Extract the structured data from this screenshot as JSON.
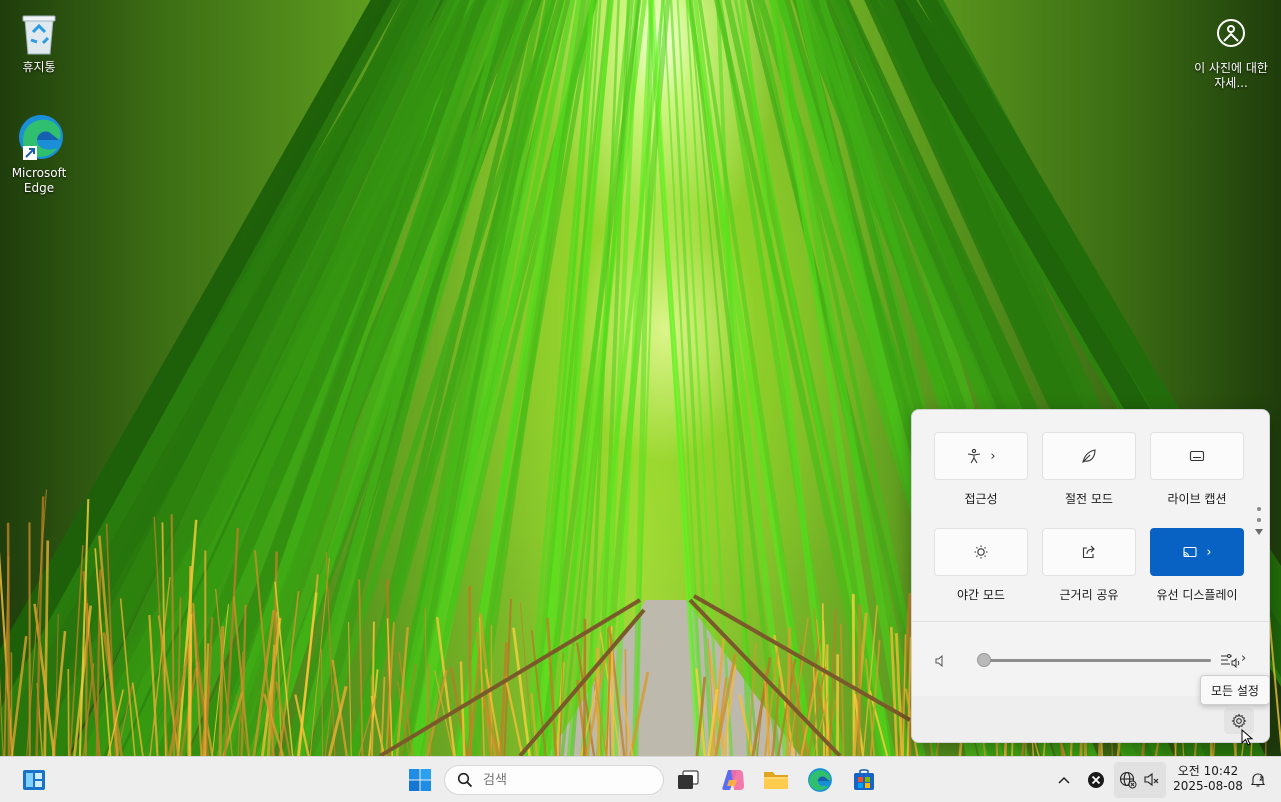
{
  "desktop": {
    "icons": [
      {
        "label": "휴지통"
      },
      {
        "label": "Microsoft Edge"
      }
    ],
    "spotlight": {
      "label": "이 사진에 대한 자세..."
    }
  },
  "quick_settings": {
    "tiles": [
      {
        "label": "접근성",
        "icon": "accessibility-icon",
        "has_chevron": true,
        "on": false
      },
      {
        "label": "절전 모드",
        "icon": "leaf-icon",
        "has_chevron": false,
        "on": false
      },
      {
        "label": "라이브 캡션",
        "icon": "captions-icon",
        "has_chevron": false,
        "on": false
      },
      {
        "label": "야간 모드",
        "icon": "night-light-icon",
        "has_chevron": false,
        "on": false
      },
      {
        "label": "근거리 공유",
        "icon": "share-icon",
        "has_chevron": false,
        "on": false
      },
      {
        "label": "유선 디스플레이",
        "icon": "cast-icon",
        "has_chevron": true,
        "on": true
      }
    ],
    "volume": {
      "level": 0,
      "icon": "speaker-muted-icon"
    },
    "settings_tooltip": "모든 설정"
  },
  "taskbar": {
    "search_placeholder": "검색",
    "clock": {
      "time": "오전 10:42",
      "date": "2025-08-08"
    }
  },
  "colors": {
    "accent": "#0862c3",
    "panel": "#f3f3f3",
    "taskbar": "#eeeeee"
  }
}
